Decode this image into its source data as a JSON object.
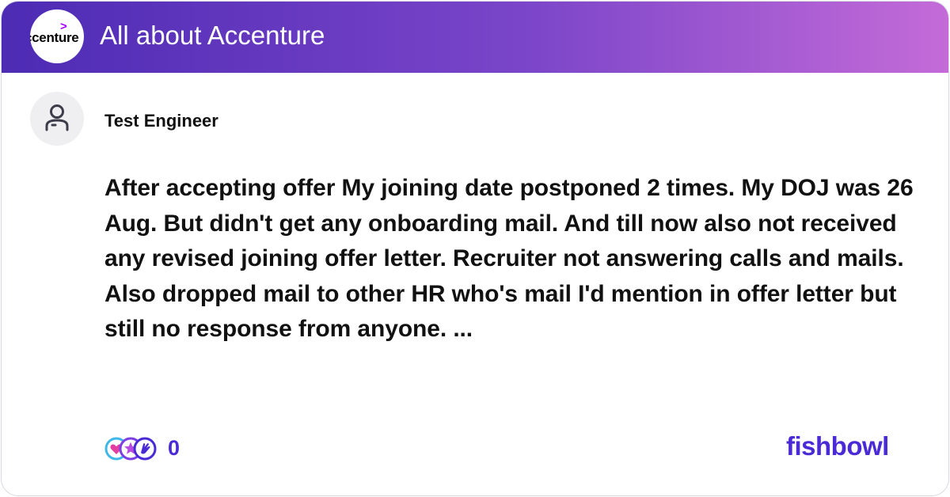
{
  "header": {
    "bowl_title": "All about Accenture",
    "logo_text": "ccenture",
    "logo_caret": ">",
    "logo_icon": "accenture-logo"
  },
  "post": {
    "author": "Test Engineer",
    "avatar_icon": "user-avatar-icon",
    "text": "After accepting offer My joining date postponed 2 times. My DOJ was 26 Aug. But didn't get any onboarding mail. And till now also not received any revised joining offer letter. Recruiter not answering calls and mails. Also dropped mail to other HR who's mail I'd mention in offer letter but still no response from anyone. ..."
  },
  "footer": {
    "reaction_icons": [
      "heart-reaction-icon",
      "star-reaction-icon",
      "clap-reaction-icon"
    ],
    "reaction_count": "0",
    "brand": "fishbowl"
  },
  "colors": {
    "header_gradient_start": "#4d2bb4",
    "header_gradient_end": "#c46bd8",
    "brand_purple": "#4a2ad6",
    "accenture_purple": "#a100ff"
  }
}
